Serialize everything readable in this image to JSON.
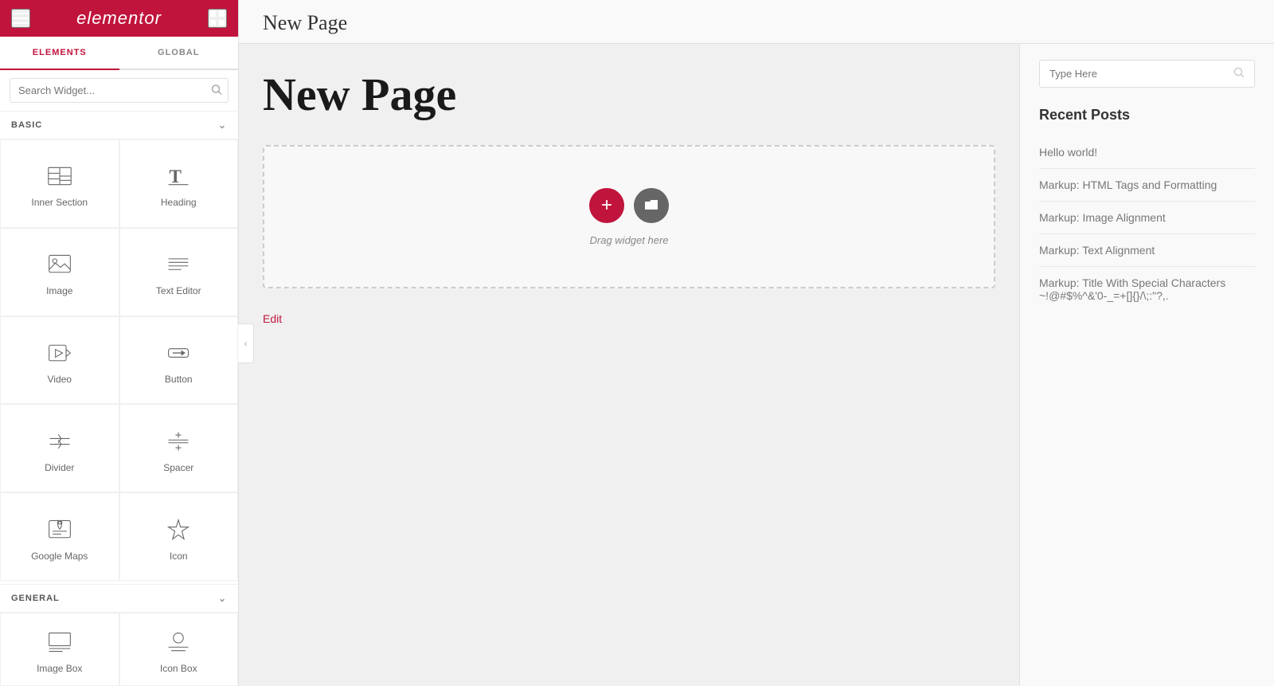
{
  "header": {
    "logo": "elementor",
    "menu_icon": "☰",
    "grid_icon": "⊞"
  },
  "sidebar": {
    "tabs": [
      {
        "label": "ELEMENTS",
        "active": true
      },
      {
        "label": "GLOBAL",
        "active": false
      }
    ],
    "search_placeholder": "Search Widget...",
    "sections": [
      {
        "title": "BASIC",
        "widgets": [
          {
            "label": "Inner Section",
            "icon": "inner-section"
          },
          {
            "label": "Heading",
            "icon": "heading"
          },
          {
            "label": "Image",
            "icon": "image"
          },
          {
            "label": "Text Editor",
            "icon": "text-editor"
          },
          {
            "label": "Video",
            "icon": "video"
          },
          {
            "label": "Button",
            "icon": "button"
          },
          {
            "label": "Divider",
            "icon": "divider"
          },
          {
            "label": "Spacer",
            "icon": "spacer"
          },
          {
            "label": "Google Maps",
            "icon": "google-maps"
          },
          {
            "label": "Icon",
            "icon": "icon"
          }
        ]
      },
      {
        "title": "GENERAL",
        "widgets": [
          {
            "label": "Image Box",
            "icon": "image-box"
          },
          {
            "label": "Icon Box",
            "icon": "icon-box"
          }
        ]
      }
    ]
  },
  "canvas": {
    "page_title_top": "New Page",
    "page_title_large": "New Page",
    "drag_hint": "Drag widget here",
    "edit_link": "Edit"
  },
  "right_sidebar": {
    "search_placeholder": "Type Here",
    "recent_posts_title": "Recent Posts",
    "posts": [
      "Hello world!",
      "Markup: HTML Tags and Formatting",
      "Markup: Image Alignment",
      "Markup: Text Alignment",
      "Markup: Title With Special Characters ~!@#$%^&'0-_=+[]{}/\\;:\"?,."
    ]
  }
}
